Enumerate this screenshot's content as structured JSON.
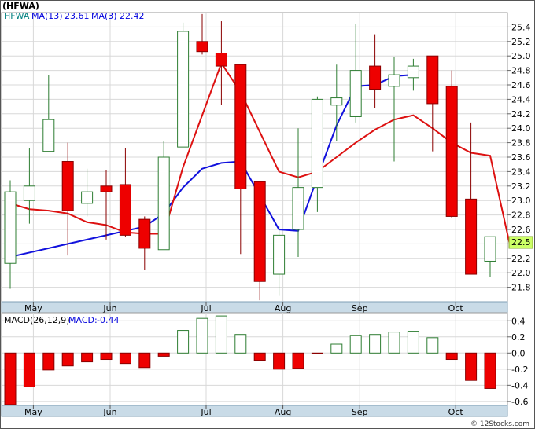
{
  "chart_data": [
    {
      "type": "candlestick",
      "title": "(HFWA)",
      "legend": [
        {
          "label": "HFWA",
          "color": "#008080"
        },
        {
          "label": "MA(13)",
          "value": "23.61",
          "color": "#0000dd"
        },
        {
          "label": "MA(3)",
          "value": "22.42",
          "color": "#0000dd"
        }
      ],
      "y_range": [
        21.6,
        25.6
      ],
      "y_ticks": [
        "21.8",
        "22.0",
        "22.2",
        "22.4",
        "22.6",
        "22.8",
        "23.0",
        "23.2",
        "23.4",
        "23.6",
        "23.8",
        "24.0",
        "24.2",
        "24.4",
        "24.6",
        "24.8",
        "25.0",
        "25.2",
        "25.4"
      ],
      "x_labels": [
        {
          "label": "May",
          "index": 1
        },
        {
          "label": "Jun",
          "index": 5
        },
        {
          "label": "Jul",
          "index": 10
        },
        {
          "label": "Aug",
          "index": 14
        },
        {
          "label": "Sep",
          "index": 18
        },
        {
          "label": "Oct",
          "index": 23
        }
      ],
      "last_price": "22.5",
      "candles": [
        {
          "o": 22.13,
          "h": 23.28,
          "l": 21.78,
          "c": 23.12
        },
        {
          "o": 23.0,
          "h": 23.72,
          "l": 22.68,
          "c": 23.2
        },
        {
          "o": 23.68,
          "h": 24.74,
          "l": 23.68,
          "c": 24.12
        },
        {
          "o": 23.54,
          "h": 23.8,
          "l": 22.24,
          "c": 22.86
        },
        {
          "o": 22.96,
          "h": 23.44,
          "l": 22.78,
          "c": 23.12
        },
        {
          "o": 23.2,
          "h": 23.42,
          "l": 22.46,
          "c": 23.12
        },
        {
          "o": 23.22,
          "h": 23.72,
          "l": 22.5,
          "c": 22.52
        },
        {
          "o": 22.74,
          "h": 22.78,
          "l": 22.04,
          "c": 22.34
        },
        {
          "o": 22.32,
          "h": 23.82,
          "l": 22.32,
          "c": 23.6
        },
        {
          "o": 23.74,
          "h": 25.46,
          "l": 23.74,
          "c": 25.34
        },
        {
          "o": 25.2,
          "h": 25.58,
          "l": 25.02,
          "c": 25.06
        },
        {
          "o": 25.04,
          "h": 25.48,
          "l": 24.32,
          "c": 24.86
        },
        {
          "o": 24.88,
          "h": 24.88,
          "l": 22.26,
          "c": 23.16
        },
        {
          "o": 23.26,
          "h": 23.26,
          "l": 21.62,
          "c": 21.88
        },
        {
          "o": 21.98,
          "h": 22.64,
          "l": 21.68,
          "c": 22.52
        },
        {
          "o": 22.6,
          "h": 24.0,
          "l": 22.22,
          "c": 23.18
        },
        {
          "o": 23.18,
          "h": 24.44,
          "l": 22.84,
          "c": 24.4
        },
        {
          "o": 24.32,
          "h": 24.88,
          "l": 23.82,
          "c": 24.42
        },
        {
          "o": 24.16,
          "h": 25.44,
          "l": 24.08,
          "c": 24.8
        },
        {
          "o": 24.86,
          "h": 25.3,
          "l": 24.28,
          "c": 24.54
        },
        {
          "o": 24.58,
          "h": 24.98,
          "l": 23.54,
          "c": 24.74
        },
        {
          "o": 24.7,
          "h": 24.96,
          "l": 24.52,
          "c": 24.86
        },
        {
          "o": 25.0,
          "h": 25.0,
          "l": 23.68,
          "c": 24.34
        },
        {
          "o": 24.58,
          "h": 24.8,
          "l": 22.76,
          "c": 22.78
        },
        {
          "o": 23.02,
          "h": 24.08,
          "l": 21.98,
          "c": 21.98
        },
        {
          "o": 22.16,
          "h": 22.5,
          "l": 21.94,
          "c": 22.5
        }
      ],
      "ma13": [
        22.22,
        null,
        null,
        null,
        null,
        null,
        null,
        22.64,
        22.82,
        23.18,
        23.44,
        23.52,
        23.54,
        null,
        22.6,
        22.58,
        23.32,
        24.04,
        24.58,
        24.6,
        24.72,
        24.74,
        null,
        null,
        null,
        null
      ],
      "ma3": [
        22.96,
        22.88,
        22.86,
        22.82,
        22.7,
        22.66,
        22.56,
        22.54,
        22.54,
        23.46,
        null,
        24.9,
        24.5,
        null,
        23.4,
        23.32,
        23.4,
        23.6,
        23.8,
        23.98,
        24.12,
        24.18,
        24.0,
        23.8,
        23.66,
        23.62,
        22.42
      ]
    },
    {
      "type": "bar",
      "title": "MACD(26,12,9)",
      "legend": [
        {
          "label": "MACD(26,12,9)",
          "color": "#000000"
        },
        {
          "label": "MACD:",
          "value": "-0.44",
          "color": "#0000dd"
        }
      ],
      "y_range": [
        -0.65,
        0.5
      ],
      "y_ticks": [
        "0.4",
        "0.2",
        "0.0",
        "-0.2",
        "-0.4",
        "-0.6"
      ],
      "x_labels": [
        {
          "label": "May",
          "index": 1
        },
        {
          "label": "Jun",
          "index": 5
        },
        {
          "label": "Jul",
          "index": 10
        },
        {
          "label": "Aug",
          "index": 14
        },
        {
          "label": "Sep",
          "index": 18
        },
        {
          "label": "Oct",
          "index": 23
        }
      ],
      "values": [
        -0.64,
        -0.42,
        -0.21,
        -0.16,
        -0.11,
        -0.08,
        -0.13,
        -0.18,
        -0.04,
        0.28,
        0.43,
        0.46,
        0.23,
        -0.09,
        -0.2,
        -0.19,
        -0.01,
        0.11,
        0.22,
        0.23,
        0.26,
        0.27,
        0.19,
        -0.08,
        -0.34,
        -0.44
      ]
    }
  ],
  "footer": {
    "copyright": "© 12Stocks.com"
  }
}
